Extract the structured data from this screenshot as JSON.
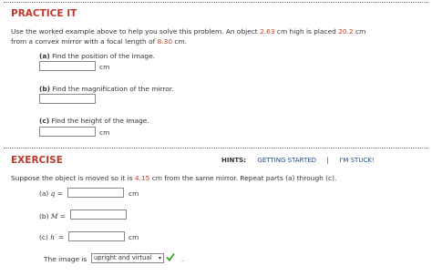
{
  "practice": {
    "heading": "PRACTICE IT",
    "intro_1": "Use the worked example above to help you solve this problem. An object",
    "height_val": "2.63",
    "intro_2": "cm high is placed",
    "distance_val": "20.2",
    "intro_3": "cm",
    "intro_4": "from a convex mirror with a focal length of",
    "focal_val": "8.30",
    "intro_5": "cm.",
    "part_a_label": "(a)",
    "part_a_text": "Find the position of the image.",
    "part_a_unit": "cm",
    "part_b_label": "(b)",
    "part_b_text": "Find the magnification of the mirror.",
    "part_c_label": "(c)",
    "part_c_text": "Find the height of the image.",
    "part_c_unit": "cm"
  },
  "exercise": {
    "heading": "EXERCISE",
    "hints_label": "HINTS:",
    "getting_started": "GETTING STARTED",
    "separator": "|",
    "im_stuck": "I'M STUCK!",
    "prompt_1": "Suppose the object is moved so it is",
    "moved_val": "4.15",
    "prompt_2": "cm from the same mirror. Repeat parts (a) through (c).",
    "a_label": "(a)",
    "a_var": "q",
    "a_eq": "=",
    "a_unit": "cm",
    "b_label": "(b)",
    "b_var": "M",
    "b_eq": "=",
    "c_label": "(c)",
    "c_var": "h′",
    "c_eq": "=",
    "c_unit": "cm",
    "image_is_label": "The image is",
    "image_select_value": "upright and virtual",
    "trailing_dot": "."
  },
  "colors": {
    "heading": "#c0392b",
    "value_red": "#cc3b1f",
    "link": "#1e4e8c",
    "check": "#3a9a2b"
  }
}
